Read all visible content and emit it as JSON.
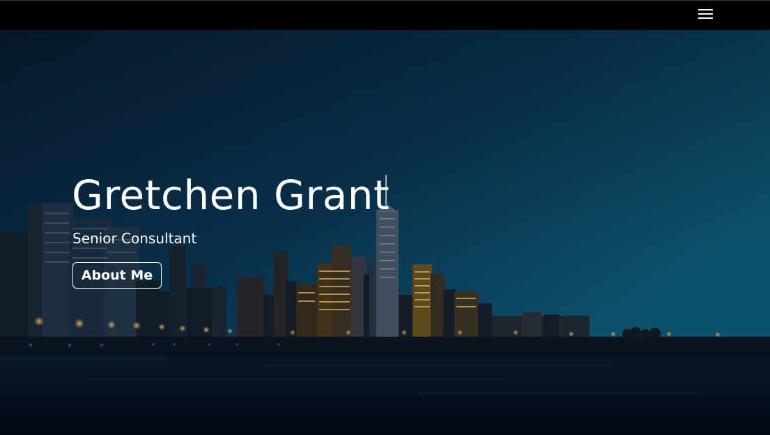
{
  "navbar": {
    "menu_icon": "hamburger-menu-icon"
  },
  "hero": {
    "background_image": "night-city-skyline-photo",
    "title": "Gretchen Grant",
    "subtitle": "Senior Consultant",
    "button_label": "About Me"
  },
  "colors": {
    "navbar_bg": "#000000",
    "sky_top": "#0b2540",
    "sky_right": "#0d5a78",
    "water": "#040d1c",
    "text": "#ffffff"
  }
}
